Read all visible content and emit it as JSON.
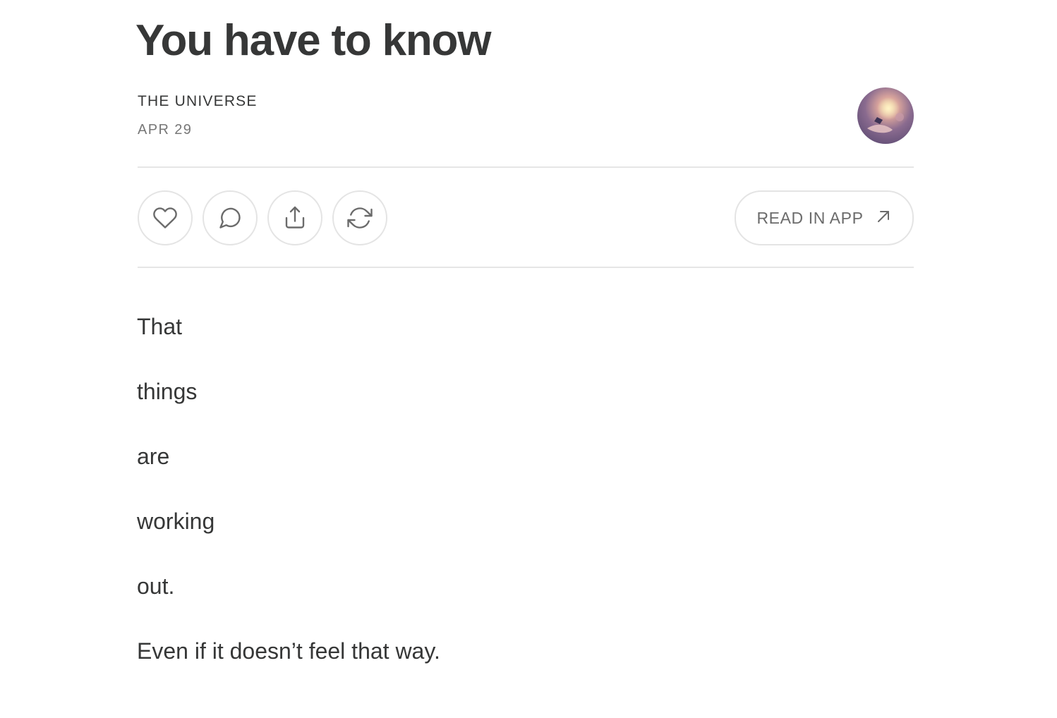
{
  "post": {
    "title": "You have to know",
    "author": "THE UNIVERSE",
    "date": "APR 29"
  },
  "actions": {
    "like_icon": "heart-icon",
    "comment_icon": "comment-bubble-icon",
    "share_icon": "share-icon",
    "restack_icon": "restack-icon",
    "read_in_app_label": "READ IN APP",
    "read_in_app_icon": "arrow-up-right-icon"
  },
  "body": {
    "paragraphs": [
      "That",
      "things",
      "are",
      "working",
      "out.",
      "Even if it doesn’t feel that way."
    ]
  },
  "colors": {
    "text": "#363737",
    "muted": "#777777",
    "border": "#e4e4e4"
  }
}
